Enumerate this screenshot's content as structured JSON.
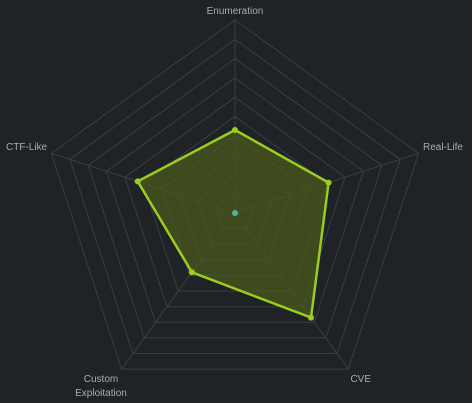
{
  "chart_data": {
    "type": "radar",
    "axes": [
      "Enumeration",
      "Real-Life",
      "CVE",
      "Custom Exploitation",
      "CTF-Like"
    ],
    "axis_label_lines": [
      [
        "Enumeration"
      ],
      [
        "Real-Life"
      ],
      [
        "CVE"
      ],
      [
        "Custom",
        "Exploitation"
      ],
      [
        "CTF-Like"
      ]
    ],
    "range": [
      0,
      10
    ],
    "grid_levels": 10,
    "series": [
      {
        "values": [
          4.3,
          5.1,
          6.7,
          3.8,
          5.3
        ]
      }
    ],
    "grid": true,
    "legend": "none"
  },
  "colors": {
    "background": "#1f2227",
    "grid": "#3a3e44",
    "series_stroke": "#9acd1e",
    "series_fill": "#4b5a1c",
    "point": "#9acd1e",
    "center_point": "#4fb3a4",
    "label": "#a9adb3"
  }
}
